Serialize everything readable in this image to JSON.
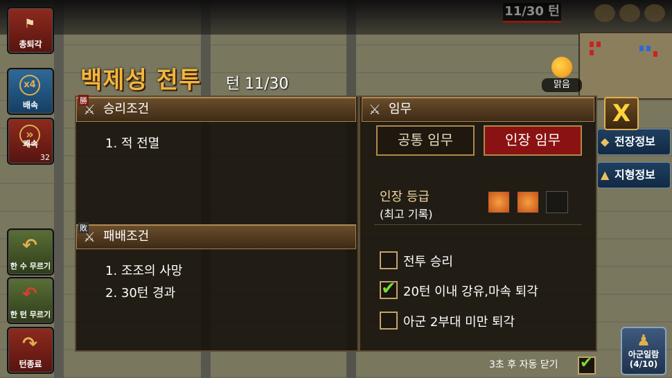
{
  "hud": {
    "turn_counter": "11/30 턴",
    "left_buttons": [
      {
        "label": "총퇴각",
        "icon": "flag-icon",
        "glyph": "⚑"
      },
      {
        "label": "배속",
        "icon": "speed-x4-icon",
        "glyph": "x4"
      },
      {
        "label": "쾌속",
        "icon": "fast-forward-icon",
        "glyph": "»",
        "count": "32"
      },
      {
        "label": "한 수 무르기",
        "icon": "undo-icon",
        "glyph": "↶"
      },
      {
        "label": "한 턴 무르기",
        "icon": "undo-turn-icon",
        "glyph": "↶"
      },
      {
        "label": "턴종료",
        "icon": "end-turn-icon",
        "glyph": "↷"
      }
    ],
    "right_buttons": [
      {
        "label": "전장정보",
        "icon": "battlefield-info-icon",
        "glyph": "◆"
      },
      {
        "label": "지형정보",
        "icon": "terrain-info-icon",
        "glyph": "▲"
      }
    ],
    "army_list": {
      "label": "아군일람",
      "count": "(4/10)"
    }
  },
  "dialog": {
    "title": "백제성 전투",
    "turn_label": "턴 11/30",
    "weather": "맑음",
    "victory": {
      "header": "승리조건",
      "badge": "勝",
      "items": [
        "1. 적 전멸"
      ]
    },
    "defeat": {
      "header": "패배조건",
      "badge": "敗",
      "items": [
        "1. 조조의 사망",
        "2. 30턴 경과"
      ]
    },
    "mission": {
      "header": "임무",
      "tabs": [
        "공통 임무",
        "인장 임무"
      ],
      "active_tab": "인장 임무",
      "grade_label": "인장 등급",
      "grade_sub": "(최고 기록)",
      "grade_earned": 2,
      "grade_total": 3,
      "seal_glyph": "印",
      "tasks": [
        {
          "label": "전투 승리",
          "checked": false
        },
        {
          "label": "20턴 이내 강유,마속 퇴각",
          "checked": true
        },
        {
          "label": "아군 2부대 미만 퇴각",
          "checked": false
        }
      ]
    },
    "close_glyph": "X",
    "auto_close_label": "3초 후 자동 닫기",
    "auto_close_checked": true
  },
  "colors": {
    "title": "#f0b73e",
    "active_tab": "#8b1212",
    "check": "#7cd83a"
  }
}
